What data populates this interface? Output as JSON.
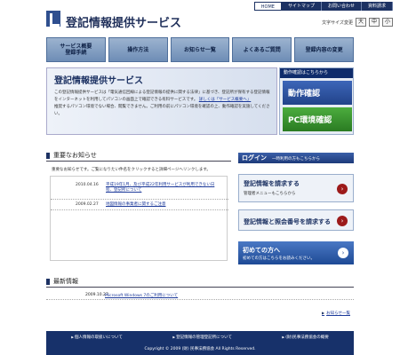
{
  "header": {
    "site_title": "登記情報提供サービス",
    "top_links": [
      "HOME",
      "サイトマップ",
      "お問い合わせ",
      "資料請求"
    ],
    "font_size_label": "文字サイズ変更",
    "font_sizes": [
      "大",
      "中",
      "小"
    ]
  },
  "nav": [
    "サービス概要\n登録手続",
    "操作方法",
    "お知らせ一覧",
    "よくあるご質問",
    "登録内容の変更"
  ],
  "hero": {
    "title": "登記情報提供サービス",
    "text_1": "この登記情報提供サービスは「電気通信回線による登記情報の提供に関する法律」に基づき、登記所が保有する登記情報をインターネットを利用してパソコンの画面上で確認できる有料サービスです。",
    "link_text": "詳しくは「サービス概要へ」",
    "text_2": "推奨するパソコン環境でない場合、閲覧できません。ご利用の前にパソコン環境を確認の上、動作確認を実施してください。"
  },
  "side": {
    "header": "動作確認はこちらから",
    "btn_1": "動作確認",
    "btn_2": "PC環境確認"
  },
  "news": {
    "heading": "重要なお知らせ",
    "description": "重要なお知らせです。ご覧になりたい件名をクリックすると詳細ページへリンクします。",
    "rows": [
      {
        "date": "2010.04.16",
        "title": "平成19年1月、及び平成22年利用サービスが利用できない日程、登記所について"
      },
      {
        "date": "2009.02.27",
        "title": "地図情報の事業者に関するご注意"
      }
    ]
  },
  "login": {
    "title": "ログイン",
    "subtitle": "一時利用の方もこちらから",
    "panel_1_main": "登記情報を請求する",
    "panel_1_sub": "管理者メニューもこちらから",
    "panel_2_main": "登記情報と照会番号を請求する",
    "panel_3_main": "初めての方へ",
    "panel_3_sub": "初めての方はこちらをお読みください。"
  },
  "latest": {
    "heading": "最新情報",
    "date": "2009.10.27",
    "title": "Microsoft Windows 7のご利用について",
    "more": "お知らせ一覧"
  },
  "footer": {
    "links": [
      "個人情報の取扱いについて",
      "登記情報の管理登記所について",
      "(財)民事法務協会の概要"
    ],
    "copyright": "Copyright © 2009 (財) 民事法務協会 All Rights Reserved."
  }
}
